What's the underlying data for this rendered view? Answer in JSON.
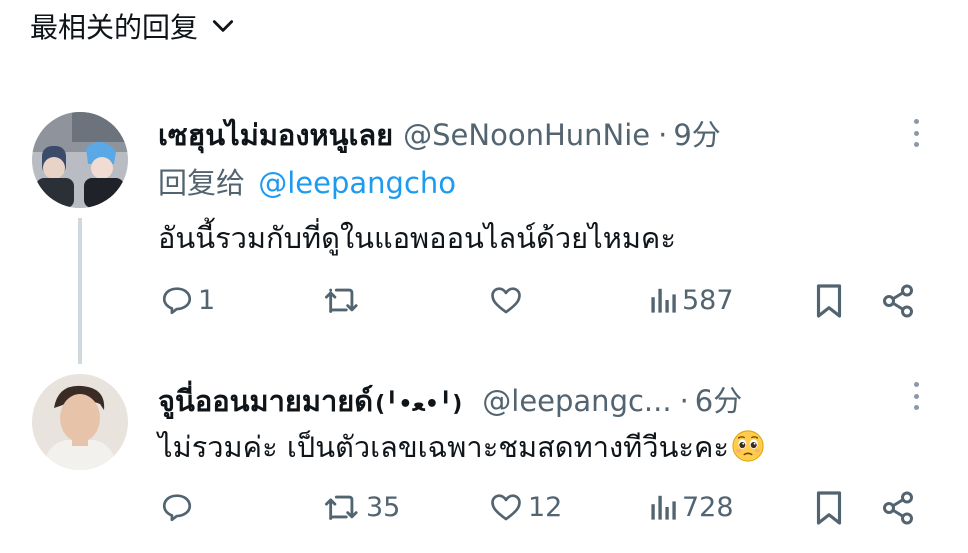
{
  "sort_header": {
    "label": "最相关的回复",
    "icon": "chevron-down-icon"
  },
  "tweets": [
    {
      "display_name": "เซฮุนไม่มองหนูเลย",
      "display_name_suffix": "",
      "handle": "@SeNoonHunNie",
      "separator": "·",
      "time": "9分",
      "reply_to_label": "回复给",
      "reply_to_handle": "@leepangcho",
      "text": "อันนี้รวมกับที่ดูในแอพออนไลน์ด้วยไหมคะ",
      "reply_count": "1",
      "retweet_count": "",
      "like_count": "",
      "view_count": "587"
    },
    {
      "display_name": "จูนี่ออนมายมายด์",
      "display_name_suffix": "(╹•ﻌ•╹)",
      "handle": "@leepangc...",
      "separator": "·",
      "time": "6分",
      "text": "ไม่รวมค่ะ เป็นตัวเลขเฉพาะชมสดทางทีวีนะคะ",
      "emoji": "pleading-face",
      "reply_count": "",
      "retweet_count": "35",
      "like_count": "12",
      "view_count": "728"
    }
  ],
  "colors": {
    "text": "#0f1419",
    "secondary": "#536471",
    "link": "#1d9bf0",
    "thread_line": "#cfd9de"
  }
}
